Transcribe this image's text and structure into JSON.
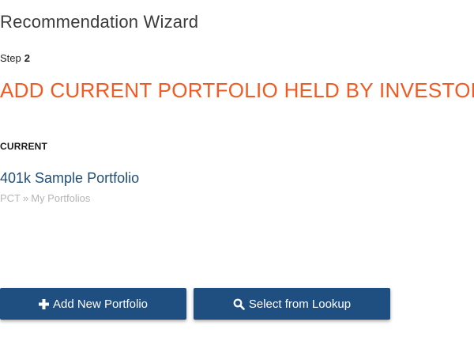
{
  "wizard": {
    "title": "Recommendation Wizard",
    "step_label": "Step",
    "step_number": "2",
    "heading": "ADD CURRENT PORTFOLIO HELD BY INVESTOR"
  },
  "current": {
    "label": "CURRENT",
    "portfolio_name": "401k Sample Portfolio",
    "path": [
      "PCT",
      "My Portfolios"
    ],
    "path_separator": "»"
  },
  "buttons": {
    "add_new": {
      "label": "Add New Portfolio",
      "icon": "plus-icon"
    },
    "lookup": {
      "label": "Select from Lookup",
      "icon": "search-icon"
    }
  },
  "colors": {
    "heading": "#f15a22",
    "link": "#1f4e79",
    "button_bg": "#1f4f81",
    "path_text": "#b5b5b5"
  }
}
